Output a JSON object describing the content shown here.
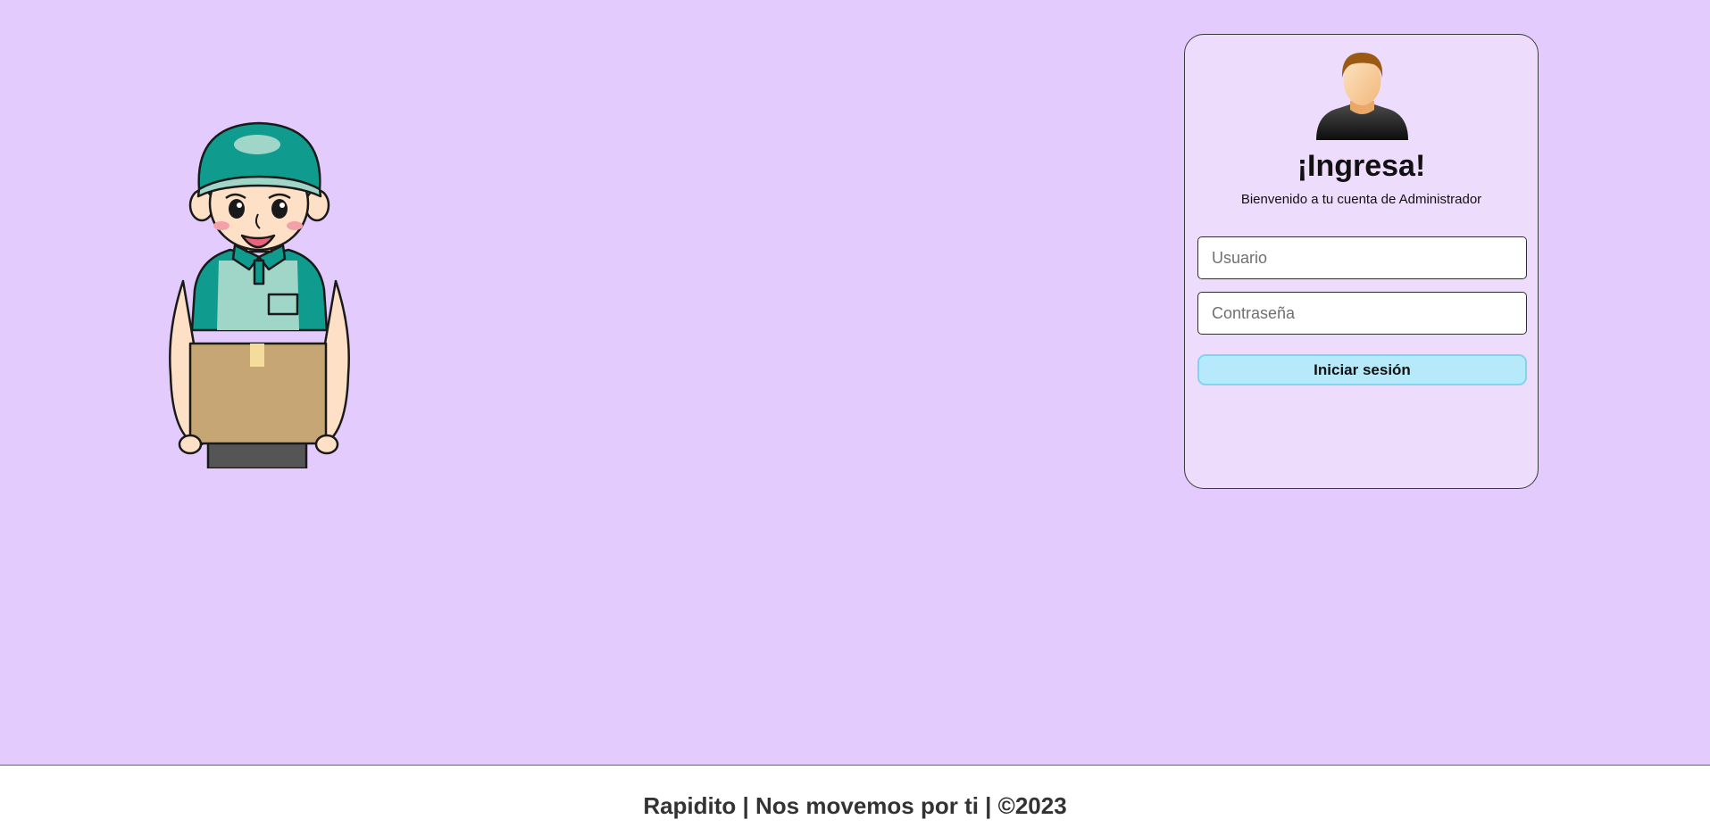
{
  "login": {
    "title": "¡Ingresa!",
    "subtitle": "Bienvenido a tu cuenta de Administrador",
    "username_placeholder": "Usuario",
    "password_placeholder": "Contraseña",
    "submit_label": "Iniciar sesión"
  },
  "footer": {
    "text": "Rapidito | Nos movemos por ti | ©2023"
  },
  "colors": {
    "page_background": "#e3cbfd",
    "card_background": "#eedcfd",
    "button_background": "#b6eafb",
    "button_border": "#7fd5ee",
    "uniform_teal": "#0f9b8e",
    "box_brown": "#c6a674"
  },
  "icons": {
    "illustration": "delivery-person-illustration",
    "avatar": "user-avatar-icon"
  }
}
